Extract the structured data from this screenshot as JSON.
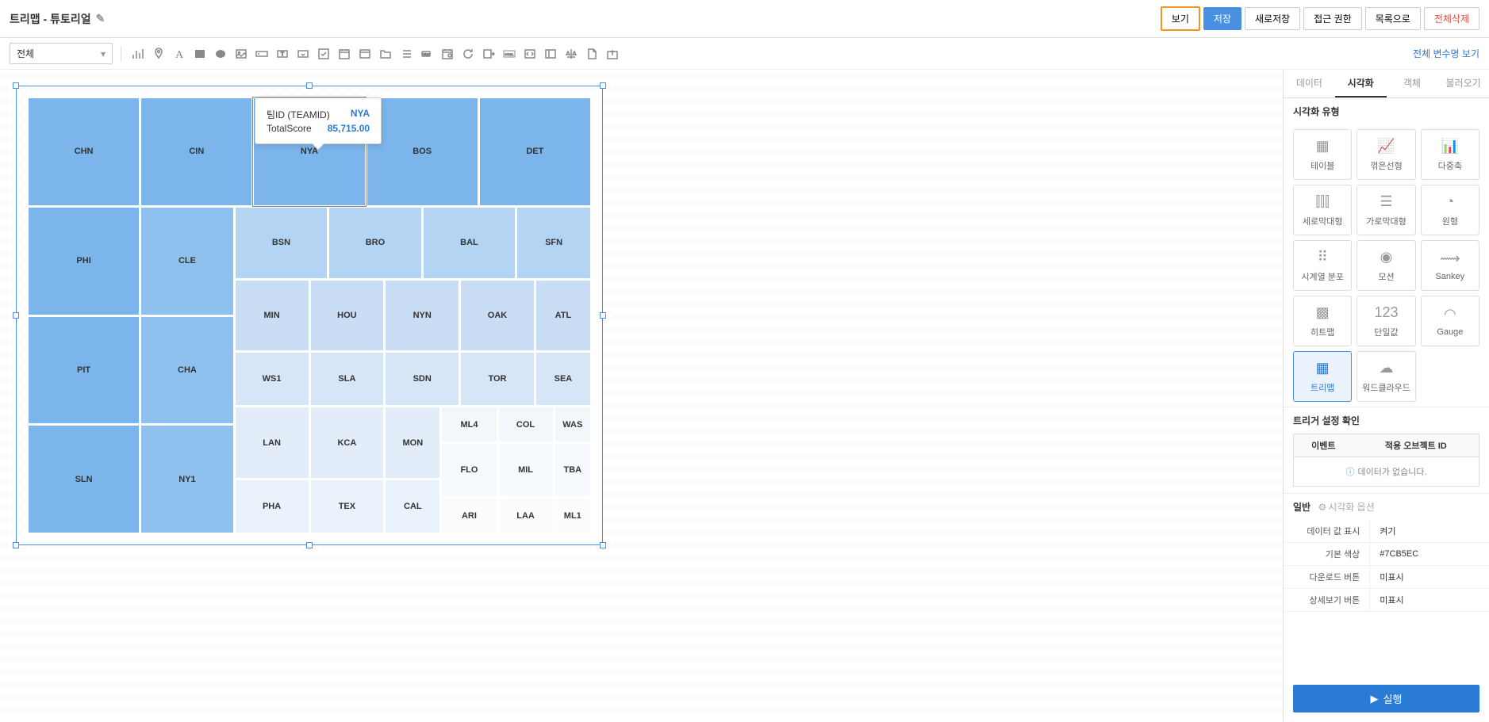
{
  "header": {
    "title": "트리맵 - 튜토리얼",
    "buttons": {
      "view": "보기",
      "save": "저장",
      "saveas": "새로저장",
      "perm": "접근 권한",
      "list": "목록으로",
      "delall": "전체삭제"
    }
  },
  "toolbar": {
    "select_label": "전체",
    "var_link": "전체 변수명 보기"
  },
  "tooltip": {
    "k1": "팀ID (TEAMID)",
    "v1": "NYA",
    "k2": "TotalScore",
    "v2": "85,715.00"
  },
  "tabs": {
    "data": "데이터",
    "viz": "시각화",
    "obj": "객체",
    "load": "불러오기"
  },
  "section": {
    "viz_type": "시각화 유형",
    "trigger": "트리거 설정 확인",
    "general": "일반",
    "viz_opt": "시각화 옵션"
  },
  "viz_types": {
    "table": "테이블",
    "line": "꺾은선형",
    "multi": "다중축",
    "vbar": "세로막대형",
    "hbar": "가로막대형",
    "pie": "원형",
    "tscatter": "시계열 분포",
    "motion": "모션",
    "sankey": "Sankey",
    "heatmap": "히트맵",
    "single": "단일값",
    "gauge": "Gauge",
    "treemap": "트리맵",
    "wordcloud": "워드클라우드"
  },
  "trigger_table": {
    "col1": "이벤트",
    "col2": "적용 오브젝트 ID",
    "empty": "데이터가 없습니다."
  },
  "props": {
    "show_val_k": "데이터 값 표시",
    "show_val_v": "켜기",
    "color_k": "기본 색상",
    "color_v": "#7CB5EC",
    "dl_k": "다운로드 버튼",
    "dl_v": "미표시",
    "detail_k": "상세보기 버튼",
    "detail_v": "미표시"
  },
  "run_btn": "실행",
  "chart_data": {
    "type": "treemap",
    "title": "",
    "value_field": "TotalScore",
    "category_field": "TEAMID",
    "highlighted": {
      "label": "NYA",
      "value": 85715.0
    },
    "items": [
      {
        "label": "CHN",
        "size": 6,
        "tier": 1
      },
      {
        "label": "PHI",
        "size": 6,
        "tier": 1
      },
      {
        "label": "PIT",
        "size": 6,
        "tier": 1
      },
      {
        "label": "SLN",
        "size": 6,
        "tier": 1
      },
      {
        "label": "CIN",
        "size": 5,
        "tier": 1
      },
      {
        "label": "CLE",
        "size": 5,
        "tier": 1
      },
      {
        "label": "CHA",
        "size": 5,
        "tier": 1
      },
      {
        "label": "NY1",
        "size": 5,
        "tier": 1
      },
      {
        "label": "NYA",
        "size": 5,
        "tier": 1,
        "highlight": true
      },
      {
        "label": "BOS",
        "size": 5,
        "tier": 1
      },
      {
        "label": "DET",
        "size": 5,
        "tier": 1
      },
      {
        "label": "BSN",
        "size": 4,
        "tier": 2
      },
      {
        "label": "BRO",
        "size": 4,
        "tier": 2
      },
      {
        "label": "BAL",
        "size": 4,
        "tier": 2
      },
      {
        "label": "SFN",
        "size": 4,
        "tier": 2
      },
      {
        "label": "MIN",
        "size": 3,
        "tier": 3
      },
      {
        "label": "HOU",
        "size": 3,
        "tier": 3
      },
      {
        "label": "NYN",
        "size": 3,
        "tier": 3
      },
      {
        "label": "OAK",
        "size": 3,
        "tier": 3
      },
      {
        "label": "ATL",
        "size": 3,
        "tier": 3
      },
      {
        "label": "WS1",
        "size": 3,
        "tier": 3
      },
      {
        "label": "SLA",
        "size": 3,
        "tier": 3
      },
      {
        "label": "SDN",
        "size": 3,
        "tier": 3
      },
      {
        "label": "TOR",
        "size": 3,
        "tier": 3
      },
      {
        "label": "SEA",
        "size": 3,
        "tier": 3
      },
      {
        "label": "LAN",
        "size": 3,
        "tier": 4
      },
      {
        "label": "KCA",
        "size": 3,
        "tier": 4
      },
      {
        "label": "MON",
        "size": 3,
        "tier": 4
      },
      {
        "label": "PHA",
        "size": 3,
        "tier": 4
      },
      {
        "label": "TEX",
        "size": 3,
        "tier": 4
      },
      {
        "label": "CAL",
        "size": 2,
        "tier": 4
      },
      {
        "label": "ML4",
        "size": 2,
        "tier": 5
      },
      {
        "label": "COL",
        "size": 2,
        "tier": 5
      },
      {
        "label": "WAS",
        "size": 2,
        "tier": 5
      },
      {
        "label": "FLO",
        "size": 2,
        "tier": 5
      },
      {
        "label": "MIL",
        "size": 2,
        "tier": 5
      },
      {
        "label": "TBA",
        "size": 2,
        "tier": 5
      },
      {
        "label": "ARI",
        "size": 2,
        "tier": 5
      },
      {
        "label": "LAA",
        "size": 2,
        "tier": 5
      },
      {
        "label": "ML1",
        "size": 2,
        "tier": 5
      }
    ]
  }
}
